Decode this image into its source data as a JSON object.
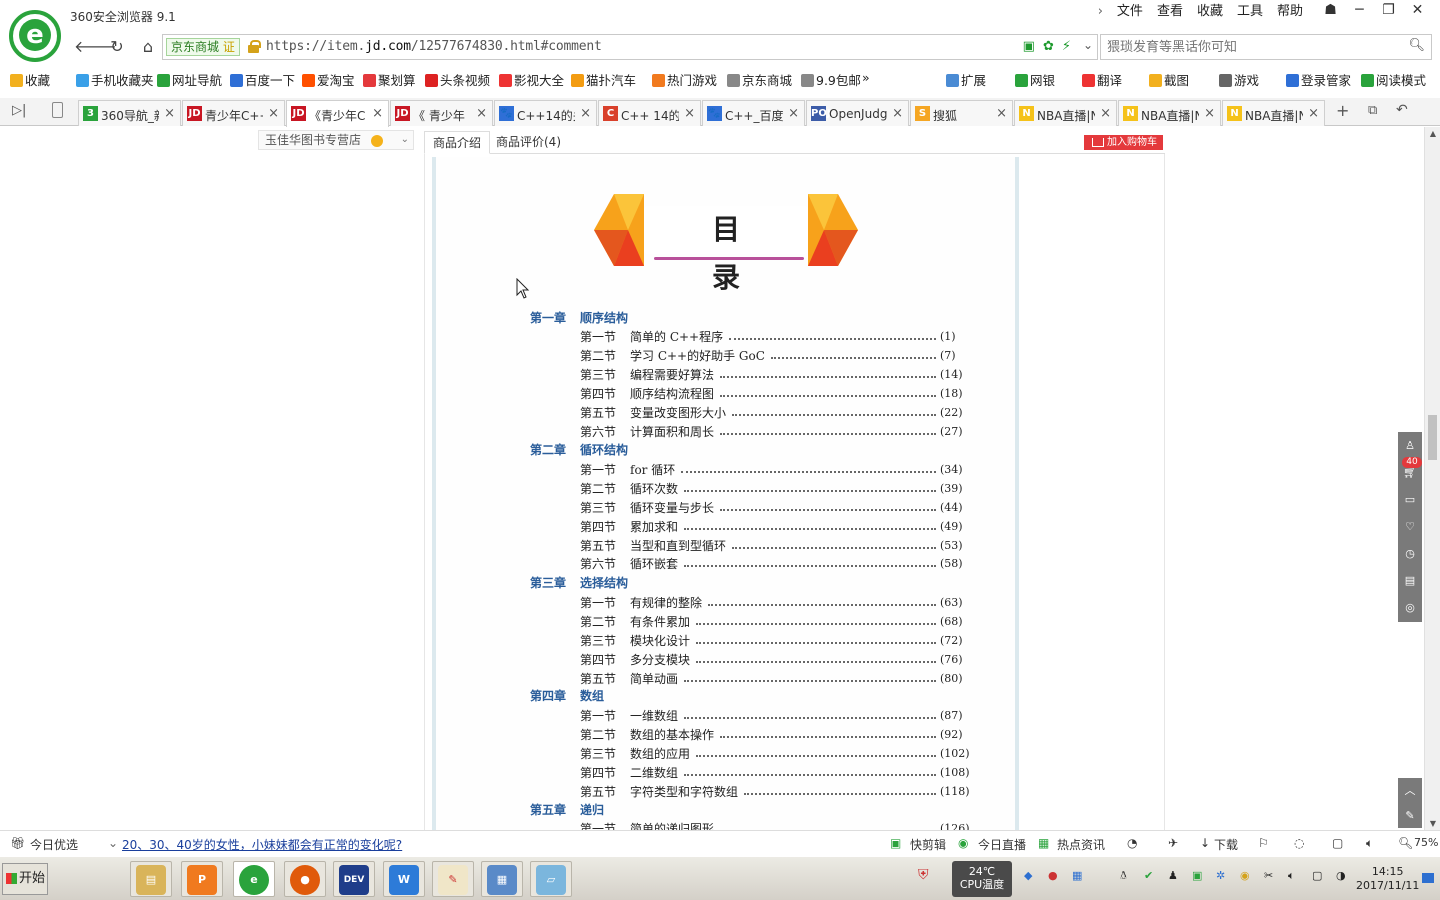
{
  "browser": {
    "app_title": "360安全浏览器 9.1",
    "menu": [
      "文件",
      "查看",
      "收藏",
      "工具",
      "帮助"
    ],
    "site_badge": "京东商城",
    "site_badge_verified": "证",
    "url_prefix": "https://item.",
    "url_domain": "jd.com",
    "url_suffix": "/12577674830.html#comment",
    "search_placeholder": "猥琐发育等黑话你可知"
  },
  "bookmarks": [
    {
      "label": "收藏",
      "icon": "star-icon",
      "color": "#f2b01e"
    },
    {
      "label": "手机收藏夹",
      "icon": "phone-icon",
      "color": "#3aa0e8"
    },
    {
      "label": "网址导航",
      "icon": "compass-icon",
      "color": "#2aa33c"
    },
    {
      "label": "百度一下",
      "icon": "baidu-paw-icon",
      "color": "#2f6fd6"
    },
    {
      "label": "爱淘宝",
      "icon": "taobao-icon",
      "color": "#ff5000"
    },
    {
      "label": "聚划算",
      "icon": "juhuasuan-icon",
      "color": "#e4393c"
    },
    {
      "label": "头条视频",
      "icon": "play-icon",
      "color": "#d22"
    },
    {
      "label": "影视大全",
      "icon": "video-icon",
      "color": "#e33"
    },
    {
      "label": "猫扑汽车",
      "icon": "cat-icon",
      "color": "#f39c12"
    },
    {
      "label": "热门游戏",
      "icon": "flame-icon",
      "color": "#f17a1f"
    },
    {
      "label": "京东商城",
      "icon": "page-icon",
      "color": "#888"
    },
    {
      "label": "9.9包邮",
      "icon": "page-icon",
      "color": "#888"
    }
  ],
  "bookmarks_right": [
    {
      "label": "扩展",
      "icon": "grid-icon",
      "color": "#4a8bd4"
    },
    {
      "label": "网银",
      "icon": "shield-icon",
      "color": "#2aa33c"
    },
    {
      "label": "翻译",
      "icon": "translate-icon",
      "color": "#e33"
    },
    {
      "label": "截图",
      "icon": "scissors-icon",
      "color": "#f2b01e"
    },
    {
      "label": "游戏",
      "icon": "gamepad-icon",
      "color": "#666"
    },
    {
      "label": "登录管家",
      "icon": "key-icon",
      "color": "#2f6fd6"
    },
    {
      "label": "阅读模式",
      "icon": "book-icon",
      "color": "#2aa33c"
    }
  ],
  "tabs": [
    {
      "label": "360导航_新",
      "fav": "3",
      "color": "#2aa33c"
    },
    {
      "label": "青少年C++",
      "fav": "JD",
      "color": "#c81623"
    },
    {
      "label": "《青少年C",
      "fav": "JD",
      "color": "#c81623"
    },
    {
      "label": "《 青少年",
      "fav": "JD",
      "color": "#c81623"
    },
    {
      "label": "C++14的关",
      "fav": "🐾",
      "color": "#2f6fd6"
    },
    {
      "label": "C++ 14的新",
      "fav": "C",
      "color": "#d9402b"
    },
    {
      "label": "C++_百度百",
      "fav": "🐾",
      "color": "#2f6fd6"
    },
    {
      "label": "OpenJudge",
      "fav": "POJ",
      "color": "#3c5ca8"
    },
    {
      "label": "搜狐",
      "fav": "S",
      "color": "#f5a623"
    },
    {
      "label": "NBA直播|N",
      "fav": "N",
      "color": "#f5c21a"
    },
    {
      "label": "NBA直播|N",
      "fav": "N",
      "color": "#f5c21a"
    },
    {
      "label": "NBA直播|N",
      "fav": "N",
      "color": "#f5c21a"
    }
  ],
  "page": {
    "store_name": "玉佳华图书专营店",
    "tab_intro": "商品介绍",
    "tab_reviews": "商品评价(4)",
    "add_to_cart": "加入购物车",
    "toc_title": "目 录",
    "side_badge": "40"
  },
  "toc": [
    {
      "type": "chapter",
      "num": "第一章",
      "title": "顺序结构"
    },
    {
      "type": "section",
      "num": "第一节",
      "title": "简单的 C++程序",
      "page": "(1)"
    },
    {
      "type": "section",
      "num": "第二节",
      "title": "学习 C++的好助手 GoC",
      "page": "(7)"
    },
    {
      "type": "section",
      "num": "第三节",
      "title": "编程需要好算法",
      "page": "(14)"
    },
    {
      "type": "section",
      "num": "第四节",
      "title": "顺序结构流程图",
      "page": "(18)"
    },
    {
      "type": "section",
      "num": "第五节",
      "title": "变量改变图形大小",
      "page": "(22)"
    },
    {
      "type": "section",
      "num": "第六节",
      "title": "计算面积和周长",
      "page": "(27)"
    },
    {
      "type": "chapter",
      "num": "第二章",
      "title": "循环结构"
    },
    {
      "type": "section",
      "num": "第一节",
      "title": "for 循环",
      "page": "(34)"
    },
    {
      "type": "section",
      "num": "第二节",
      "title": "循环次数",
      "page": "(39)"
    },
    {
      "type": "section",
      "num": "第三节",
      "title": "循环变量与步长",
      "page": "(44)"
    },
    {
      "type": "section",
      "num": "第四节",
      "title": "累加求和",
      "page": "(49)"
    },
    {
      "type": "section",
      "num": "第五节",
      "title": "当型和直到型循环",
      "page": "(53)"
    },
    {
      "type": "section",
      "num": "第六节",
      "title": "循环嵌套",
      "page": "(58)"
    },
    {
      "type": "chapter",
      "num": "第三章",
      "title": "选择结构"
    },
    {
      "type": "section",
      "num": "第一节",
      "title": "有规律的整除",
      "page": "(63)"
    },
    {
      "type": "section",
      "num": "第二节",
      "title": "有条件累加",
      "page": "(68)"
    },
    {
      "type": "section",
      "num": "第三节",
      "title": "模块化设计",
      "page": "(72)"
    },
    {
      "type": "section",
      "num": "第四节",
      "title": "多分支模块",
      "page": "(76)"
    },
    {
      "type": "section",
      "num": "第五节",
      "title": "简单动画",
      "page": "(80)"
    },
    {
      "type": "chapter",
      "num": "第四章",
      "title": "数组"
    },
    {
      "type": "section",
      "num": "第一节",
      "title": "一维数组",
      "page": "(87)"
    },
    {
      "type": "section",
      "num": "第二节",
      "title": "数组的基本操作",
      "page": "(92)"
    },
    {
      "type": "section",
      "num": "第三节",
      "title": "数组的应用",
      "page": "(102)"
    },
    {
      "type": "section",
      "num": "第四节",
      "title": "二维数组",
      "page": "(108)"
    },
    {
      "type": "section",
      "num": "第五节",
      "title": "字符类型和字符数组",
      "page": "(118)"
    },
    {
      "type": "chapter",
      "num": "第五章",
      "title": "递归"
    },
    {
      "type": "section",
      "num": "第一节",
      "title": "简单的递归图形",
      "page": "(126)"
    }
  ],
  "statusbar": {
    "today_pick": "今日优选",
    "news": "20、30、40岁的女性，小妹妹都会有正常的变化呢?",
    "items": [
      "快剪辑",
      "今日直播",
      "热点资讯",
      "下载"
    ],
    "zoom": "75%"
  },
  "taskbar": {
    "start": "开始",
    "temp": "24℃",
    "temp_label": "CPU温度",
    "time": "14:15",
    "date": "2017/11/11"
  }
}
